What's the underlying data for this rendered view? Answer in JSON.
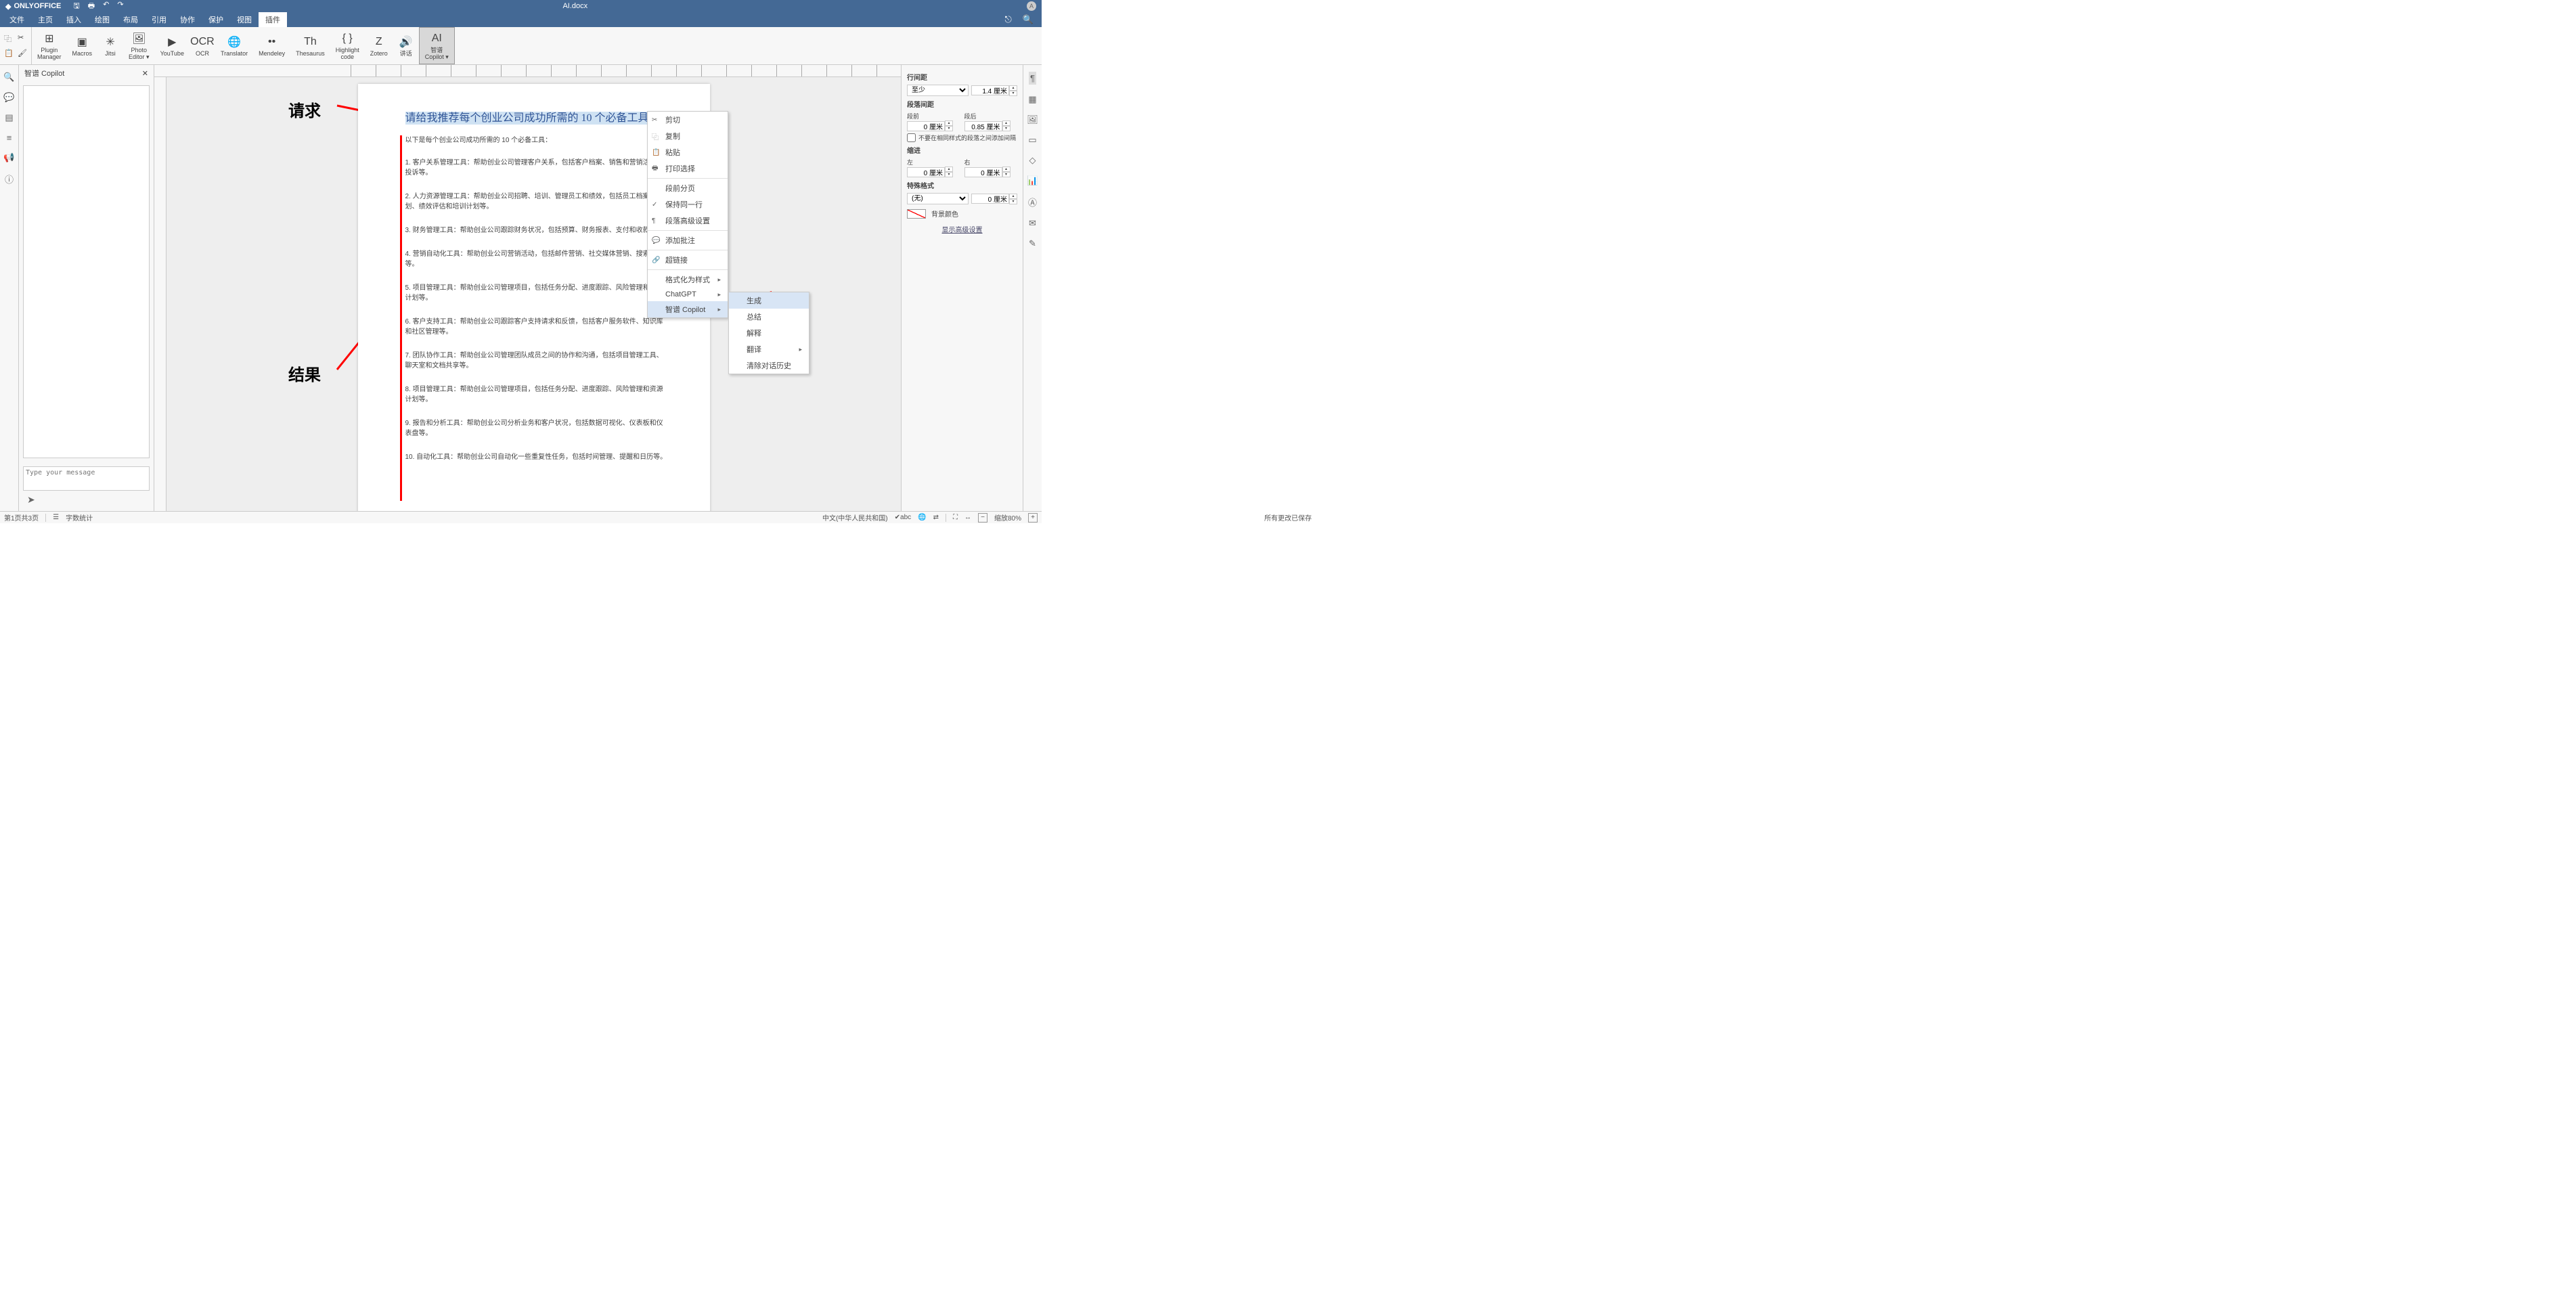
{
  "app_name": "ONLYOFFICE",
  "doc_name": "AI.docx",
  "user_initial": "A",
  "menu_tabs": [
    "文件",
    "主页",
    "插入",
    "绘图",
    "布局",
    "引用",
    "协作",
    "保护",
    "视图",
    "插件"
  ],
  "active_tab_index": 9,
  "ribbon": {
    "items": [
      {
        "label": "Plugin\nManager",
        "icon": "⊞"
      },
      {
        "label": "Macros",
        "icon": "▣"
      },
      {
        "label": "Jitsi",
        "icon": "✳"
      },
      {
        "label": "Photo\nEditor ▾",
        "icon": "🖼"
      },
      {
        "label": "YouTube",
        "icon": "▶"
      },
      {
        "label": "OCR",
        "icon": "OCR"
      },
      {
        "label": "Translator",
        "icon": "🌐"
      },
      {
        "label": "Mendeley",
        "icon": "••"
      },
      {
        "label": "Thesaurus",
        "icon": "Th"
      },
      {
        "label": "Highlight\ncode",
        "icon": "{ }"
      },
      {
        "label": "Zotero",
        "icon": "Z"
      },
      {
        "label": "讲话",
        "icon": "🔊"
      },
      {
        "label": "智谱\nCopilot ▾",
        "icon": "AI",
        "selected": true
      }
    ]
  },
  "copilot": {
    "title": "智谱 Copilot",
    "placeholder": "Type your message"
  },
  "annotations": {
    "request": "请求",
    "result": "结果"
  },
  "document": {
    "prompt": "请给我推荐每个创业公司成功所需的 10 个必备工具",
    "answer_title": "以下是每个创业公司成功所需的 10 个必备工具：",
    "items": [
      "1. 客户关系管理工具：帮助创业公司管理客户关系，包括客户档案、销售和营销活动和投诉等。",
      "2. 人力资源管理工具：帮助创业公司招聘、培训、管理员工和绩效，包括员工档案计划、绩效评估和培训计划等。",
      "3. 财务管理工具：帮助创业公司跟踪财务状况，包括预算、财务报表、支付和收款等。",
      "4. 营销自动化工具：帮助创业公司营销活动，包括邮件营销、社交媒体营销、搜索告等。",
      "5. 项目管理工具：帮助创业公司管理项目，包括任务分配、进度跟踪、风险管理和资源计划等。",
      "6. 客户支持工具：帮助创业公司跟踪客户支持请求和反馈，包括客户服务软件、知识库和社区管理等。",
      "7. 团队协作工具：帮助创业公司管理团队成员之间的协作和沟通，包括项目管理工具、聊天室和文档共享等。",
      "8. 项目管理工具：帮助创业公司管理项目，包括任务分配、进度跟踪、风险管理和资源计划等。",
      "9. 报告和分析工具：帮助创业公司分析业务和客户状况，包括数据可视化、仪表板和仪表盘等。",
      "10. 自动化工具：帮助创业公司自动化一些重复性任务，包括时间管理、提醒和日历等。"
    ]
  },
  "context_menu": {
    "items": [
      {
        "label": "剪切",
        "icon": "✂"
      },
      {
        "label": "复制",
        "icon": "⿻"
      },
      {
        "label": "粘贴",
        "icon": "📋"
      },
      {
        "label": "打印选择",
        "icon": "🖶"
      },
      {
        "sep": true
      },
      {
        "label": "段前分页",
        "icon": ""
      },
      {
        "label": "保持同一行",
        "icon": "✓"
      },
      {
        "label": "段落高级设置",
        "icon": "¶"
      },
      {
        "sep": true
      },
      {
        "label": "添加批注",
        "icon": "💬"
      },
      {
        "sep": true
      },
      {
        "label": "超链接",
        "icon": "🔗"
      },
      {
        "sep": true
      },
      {
        "label": "格式化为样式",
        "submenu": true
      },
      {
        "label": "ChatGPT",
        "submenu": true
      },
      {
        "label": "智谱 Copilot",
        "submenu": true,
        "highlight": true
      }
    ],
    "submenu_items": [
      {
        "label": "生成",
        "highlight": true
      },
      {
        "label": "总结"
      },
      {
        "label": "解释"
      },
      {
        "label": "翻译",
        "submenu": true
      },
      {
        "label": "清除对话历史"
      }
    ]
  },
  "right_panel": {
    "line_spacing_title": "行间距",
    "line_spacing_mode": "至少",
    "line_spacing_value": "1.4 厘米",
    "para_spacing_title": "段落间距",
    "before_label": "段前",
    "before_value": "0 厘米",
    "after_label": "段后",
    "after_value": "0.85 厘米",
    "no_space_same_style": "不要在相同样式的段落之间添加间隔",
    "indent_title": "缩进",
    "left_label": "左",
    "left_value": "0 厘米",
    "right_label": "右",
    "right_value": "0 厘米",
    "special_title": "特殊格式",
    "special_mode": "(无)",
    "special_value": "0 厘米",
    "bg_color_label": "背景颜色",
    "advanced": "显示高级设置"
  },
  "status": {
    "page": "第1页共3页",
    "wordcount": "字数统计",
    "saved": "所有更改已保存",
    "lang": "中文(中华人民共和国)",
    "zoom": "缩放80%"
  }
}
